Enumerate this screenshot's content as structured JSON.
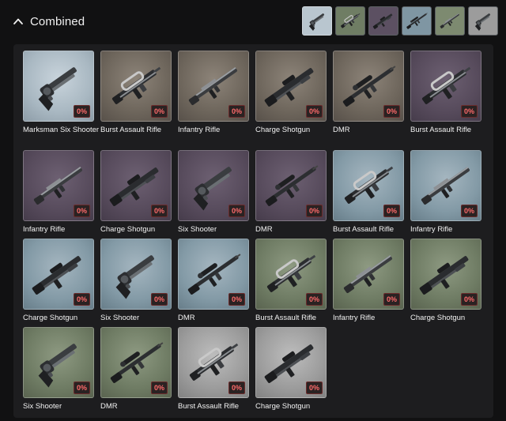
{
  "header": {
    "title": "Combined",
    "toggle_icon": "chevron-up-icon"
  },
  "thumbnails": [
    {
      "name": "thumb-slate",
      "color": "#b9c6cf",
      "active": true
    },
    {
      "name": "thumb-sand",
      "color": "#6f7d64",
      "active": false
    },
    {
      "name": "thumb-plum",
      "color": "#5c5062",
      "active": false
    },
    {
      "name": "thumb-steel",
      "color": "#7f96a3",
      "active": false
    },
    {
      "name": "thumb-sage",
      "color": "#7d8a70",
      "active": false
    },
    {
      "name": "thumb-silver",
      "color": "#9c9c9c",
      "active": false
    }
  ],
  "items": [
    {
      "label": "Marksman Six Shooter",
      "percent": "0%",
      "bg": "slate",
      "weapon": "revolver"
    },
    {
      "label": "Burst Assault Rifle",
      "percent": "0%",
      "bg": "sand",
      "weapon": "burst"
    },
    {
      "label": "Infantry Rifle",
      "percent": "0%",
      "bg": "sand",
      "weapon": "infantry"
    },
    {
      "label": "Charge Shotgun",
      "percent": "0%",
      "bg": "sand",
      "weapon": "shotgun"
    },
    {
      "label": "DMR",
      "percent": "0%",
      "bg": "sand",
      "weapon": "dmr"
    },
    {
      "label": "Burst Assault Rifle",
      "percent": "0%",
      "bg": "plum",
      "weapon": "burst"
    },
    {
      "label": "Infantry Rifle",
      "percent": "0%",
      "bg": "plum",
      "weapon": "infantry"
    },
    {
      "label": "Charge Shotgun",
      "percent": "0%",
      "bg": "plum",
      "weapon": "shotgun"
    },
    {
      "label": "Six Shooter",
      "percent": "0%",
      "bg": "plum",
      "weapon": "revolver"
    },
    {
      "label": "DMR",
      "percent": "0%",
      "bg": "plum",
      "weapon": "dmr"
    },
    {
      "label": "Burst Assault Rifle",
      "percent": "0%",
      "bg": "steel",
      "weapon": "burst"
    },
    {
      "label": "Infantry Rifle",
      "percent": "0%",
      "bg": "steel",
      "weapon": "infantry"
    },
    {
      "label": "Charge Shotgun",
      "percent": "0%",
      "bg": "steel",
      "weapon": "shotgun"
    },
    {
      "label": "Six Shooter",
      "percent": "0%",
      "bg": "steel",
      "weapon": "revolver"
    },
    {
      "label": "DMR",
      "percent": "0%",
      "bg": "steel",
      "weapon": "dmr"
    },
    {
      "label": "Burst Assault Rifle",
      "percent": "0%",
      "bg": "sage",
      "weapon": "burst"
    },
    {
      "label": "Infantry Rifle",
      "percent": "0%",
      "bg": "sage",
      "weapon": "infantry"
    },
    {
      "label": "Charge Shotgun",
      "percent": "0%",
      "bg": "sage",
      "weapon": "shotgun"
    },
    {
      "label": "Six Shooter",
      "percent": "0%",
      "bg": "sage",
      "weapon": "revolver"
    },
    {
      "label": "DMR",
      "percent": "0%",
      "bg": "sage",
      "weapon": "dmr"
    },
    {
      "label": "Burst Assault Rifle",
      "percent": "0%",
      "bg": "silver",
      "weapon": "burst"
    },
    {
      "label": "Charge Shotgun",
      "percent": "0%",
      "bg": "silver",
      "weapon": "shotgun"
    }
  ]
}
